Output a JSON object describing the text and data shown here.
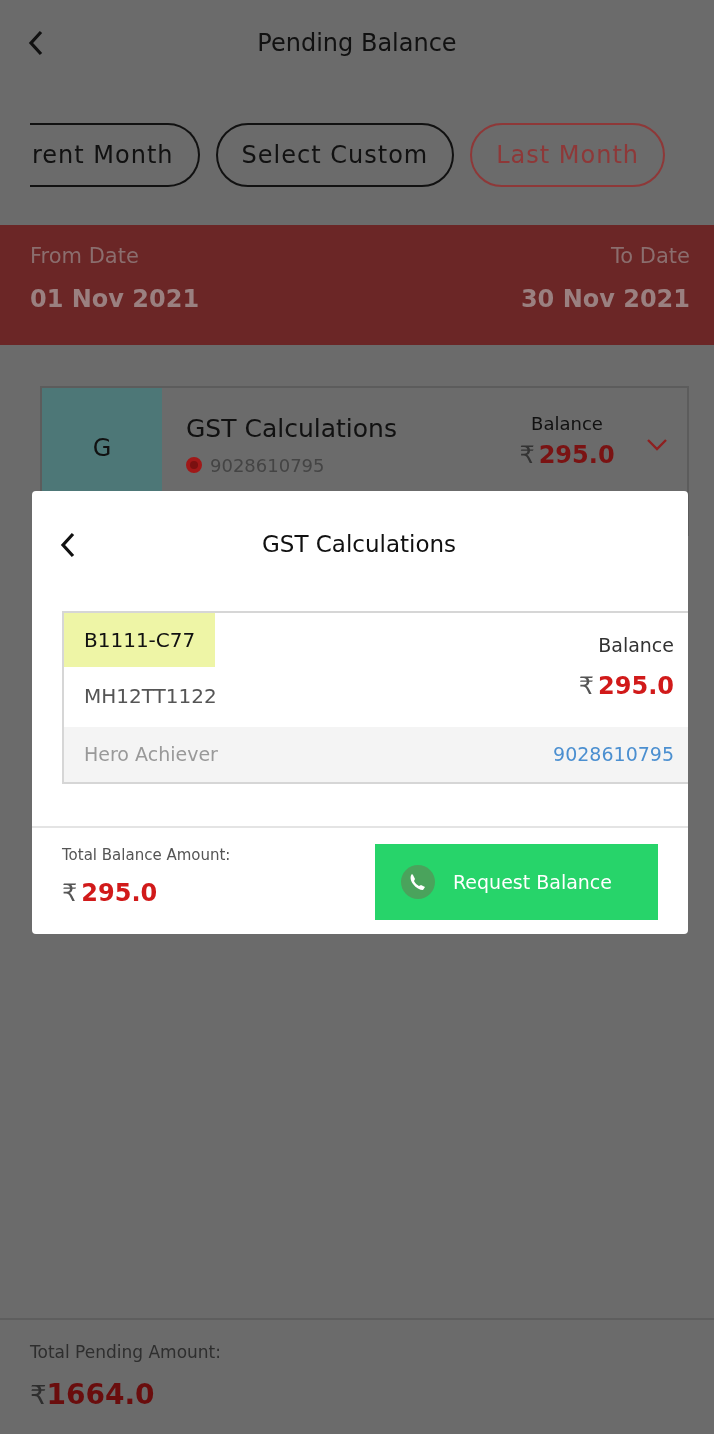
{
  "header": {
    "title": "Pending Balance"
  },
  "filters": [
    {
      "label": "rent Month",
      "selected": false
    },
    {
      "label": "Select Custom",
      "selected": false
    },
    {
      "label": "Last Month",
      "selected": true
    }
  ],
  "date_range": {
    "from_label": "From Date",
    "from_value": "01 Nov 2021",
    "to_label": "To Date",
    "to_value": "30 Nov 2021"
  },
  "customer_card": {
    "initial": "G",
    "name": "GST Calculations",
    "phone": "9028610795",
    "balance_label": "Balance",
    "currency": "₹",
    "balance": "295.0",
    "expanded": false
  },
  "dialog": {
    "title": "GST Calculations",
    "vehicle": {
      "tag": "B1111-C77",
      "number": "MH12TT1122",
      "balance_label": "Balance",
      "currency": "₹",
      "balance": "295.0",
      "model": "Hero Achiever",
      "phone": "9028610795"
    },
    "total_label": "Total Balance Amount:",
    "total_currency": "₹",
    "total": "295.0",
    "request_button": "Request Balance"
  },
  "footer": {
    "label": "Total Pending Amount:",
    "currency": "₹",
    "amount": "1664.0"
  }
}
